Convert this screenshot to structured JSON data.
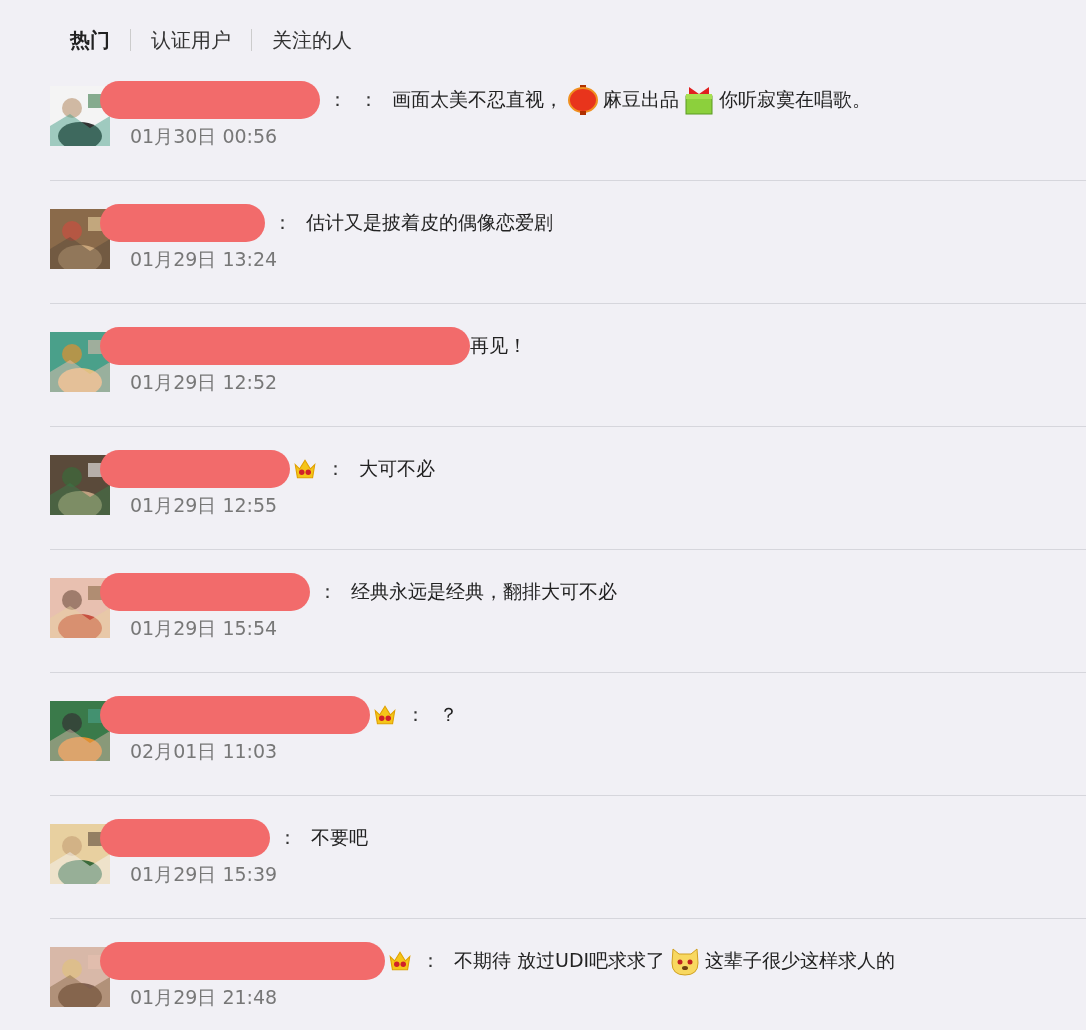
{
  "tabs": [
    {
      "label": "热门",
      "selected": true
    },
    {
      "label": "认证用户",
      "selected": false
    },
    {
      "label": "关注的人",
      "selected": false
    }
  ],
  "comments": [
    {
      "badge": false,
      "colon": "：  ：",
      "segments": [
        {
          "kind": "text",
          "text": "画面太美不忍直视，"
        },
        {
          "kind": "emoji"
        },
        {
          "kind": "text",
          "text": "麻豆出品"
        },
        {
          "kind": "emoji"
        },
        {
          "kind": "text",
          "text": "你听寂寞在唱歌。"
        }
      ],
      "time": "01月30日 00:56"
    },
    {
      "badge": false,
      "colon": "：",
      "segments": [
        {
          "kind": "text",
          "text": "估计又是披着皮的偶像恋爱剧"
        }
      ],
      "time": "01月29日 13:24"
    },
    {
      "badge": false,
      "segments": [
        {
          "kind": "text",
          "text": "再见！"
        }
      ],
      "time": "01月29日 12:52"
    },
    {
      "badge": true,
      "colon": "：",
      "segments": [
        {
          "kind": "text",
          "text": "大可不必"
        }
      ],
      "time": "01月29日 12:55"
    },
    {
      "badge": false,
      "colon": "：",
      "segments": [
        {
          "kind": "text",
          "text": "经典永远是经典，翻排大可不必"
        }
      ],
      "time": "01月29日 15:54"
    },
    {
      "badge": true,
      "colon": "：",
      "segments": [
        {
          "kind": "text",
          "text": "？"
        }
      ],
      "time": "02月01日 11:03"
    },
    {
      "badge": false,
      "colon": "：",
      "segments": [
        {
          "kind": "text",
          "text": "不要吧"
        }
      ],
      "time": "01月29日 15:39"
    },
    {
      "badge": true,
      "colon": "：",
      "segments": [
        {
          "kind": "text",
          "text": "不期待 放过UDI吧求求了"
        },
        {
          "kind": "emoji"
        },
        {
          "kind": "text",
          "text": "这辈子很少这样求人的"
        }
      ],
      "time": "01月29日 21:48"
    }
  ]
}
